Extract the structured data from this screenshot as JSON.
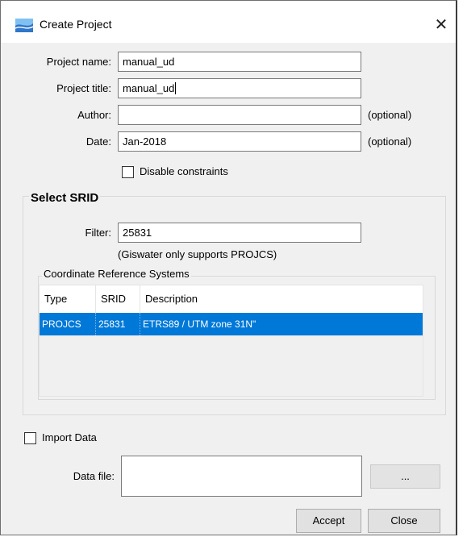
{
  "window": {
    "title": "Create Project",
    "close_glyph": "✕",
    "app_icon": "giswater-icon"
  },
  "form": {
    "project_name": {
      "label": "Project name:",
      "value": "manual_ud"
    },
    "project_title": {
      "label": "Project title:",
      "value": "manual_ud"
    },
    "author": {
      "label": "Author:",
      "value": "",
      "hint": "(optional)"
    },
    "date": {
      "label": "Date:",
      "value": "Jan-2018",
      "hint": "(optional)"
    },
    "disable_constraints": {
      "label": "Disable constraints",
      "checked": false
    }
  },
  "srid": {
    "title": "Select SRID",
    "filter_label": "Filter:",
    "filter_value": "25831",
    "note": "(Giswater only supports PROJCS)",
    "crs_title": "Coordinate Reference Systems",
    "columns": [
      "Type",
      "SRID",
      "Description"
    ],
    "rows": [
      {
        "type": "PROJCS",
        "srid": "25831",
        "description": "ETRS89 / UTM zone 31N\"",
        "selected": true
      }
    ]
  },
  "import": {
    "label": "Import Data",
    "checked": false,
    "data_file_label": "Data file:",
    "data_file_value": "",
    "browse_label": "..."
  },
  "buttons": {
    "accept": "Accept",
    "close": "Close"
  },
  "colors": {
    "selection": "#0078d7",
    "dialog_bg": "#f0f0f0",
    "icon_blue": "#2e77c9"
  }
}
